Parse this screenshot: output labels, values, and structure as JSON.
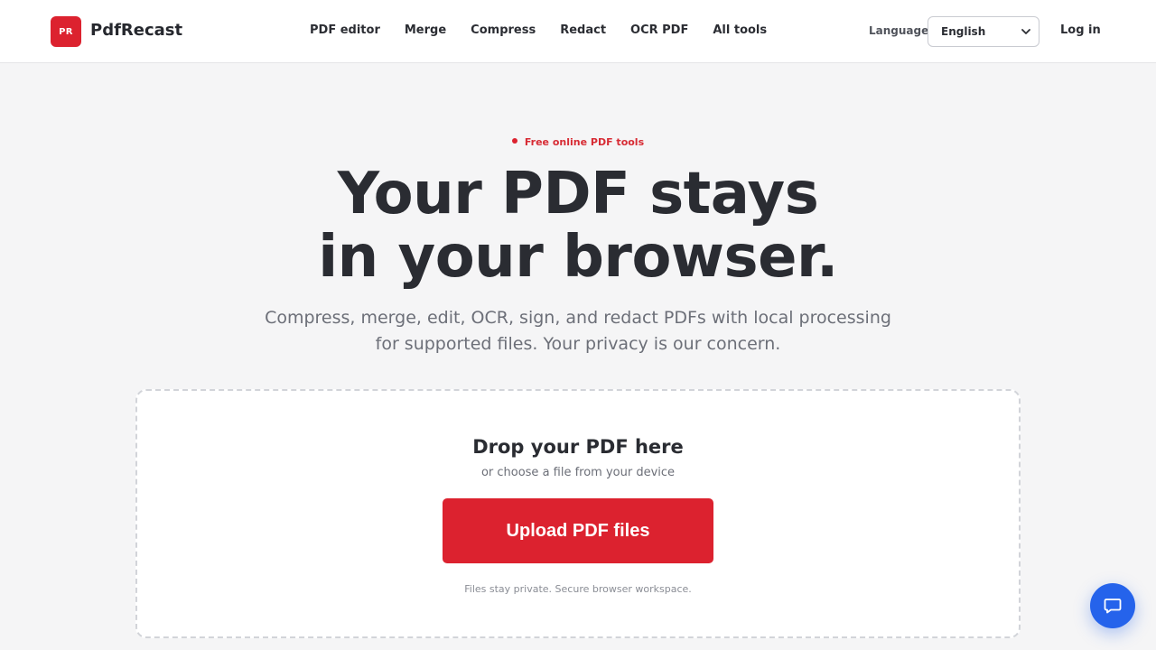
{
  "brand": {
    "badge": "PR",
    "name": "PdfRecast",
    "accent": "#dc222f"
  },
  "nav": [
    {
      "label": "PDF editor"
    },
    {
      "label": "Merge"
    },
    {
      "label": "Compress"
    },
    {
      "label": "Redact"
    },
    {
      "label": "OCR PDF"
    },
    {
      "label": "All tools"
    }
  ],
  "language": {
    "label": "Language",
    "selected": "English"
  },
  "login": "Log in",
  "hero": {
    "eyebrow": "Free online PDF tools",
    "title_line1": "Your PDF stays",
    "title_line2": "in your browser.",
    "subtitle_line1": "Compress, merge, edit, OCR, sign, and redact PDFs with local processing",
    "subtitle_line2": "for supported files. Your privacy is our concern."
  },
  "dropzone": {
    "title": "Drop your PDF here",
    "subtitle": "or choose a file from your device",
    "button": "Upload PDF files",
    "note": "Files stay private. Secure browser workspace."
  },
  "icons": {
    "chat": "chat-icon",
    "dropdown": "chevron-down-icon"
  },
  "colors": {
    "chat_button": "#2563eb"
  }
}
